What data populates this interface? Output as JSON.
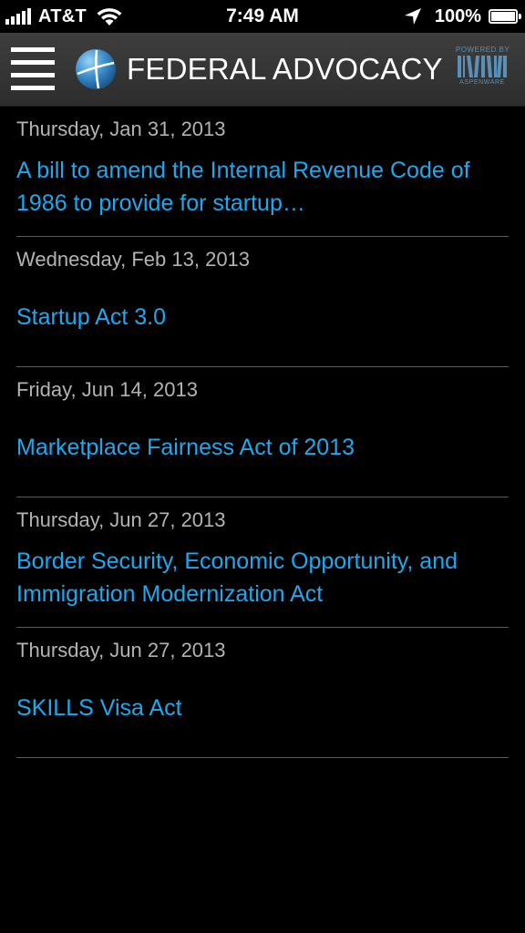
{
  "status_bar": {
    "carrier": "AT&T",
    "time": "7:49 AM",
    "battery": "100%"
  },
  "header": {
    "title": "FEDERAL ADVOCACY",
    "powered_by": "POWERED BY",
    "vendor": "ASPENWARE",
    "icons": [
      "menu-icon",
      "globe-logo",
      "aspenware-logo"
    ]
  },
  "items": [
    {
      "date": "Thursday, Jan 31, 2013",
      "title": "A bill to amend the Internal Revenue Code of 1986 to provide for startup…"
    },
    {
      "date": "Wednesday, Feb 13, 2013",
      "title": "Startup Act 3.0"
    },
    {
      "date": "Friday, Jun 14, 2013",
      "title": "Marketplace Fairness Act of 2013"
    },
    {
      "date": "Thursday, Jun 27, 2013",
      "title": "Border Security, Economic Opportunity, and Immigration Modernization Act"
    },
    {
      "date": "Thursday, Jun 27, 2013",
      "title": "SKILLS Visa Act"
    }
  ],
  "colors": {
    "background": "#000000",
    "header": "#333333",
    "link": "#1fa8ee",
    "date": "#b3b3b3",
    "divider": "#5a5a5a"
  }
}
